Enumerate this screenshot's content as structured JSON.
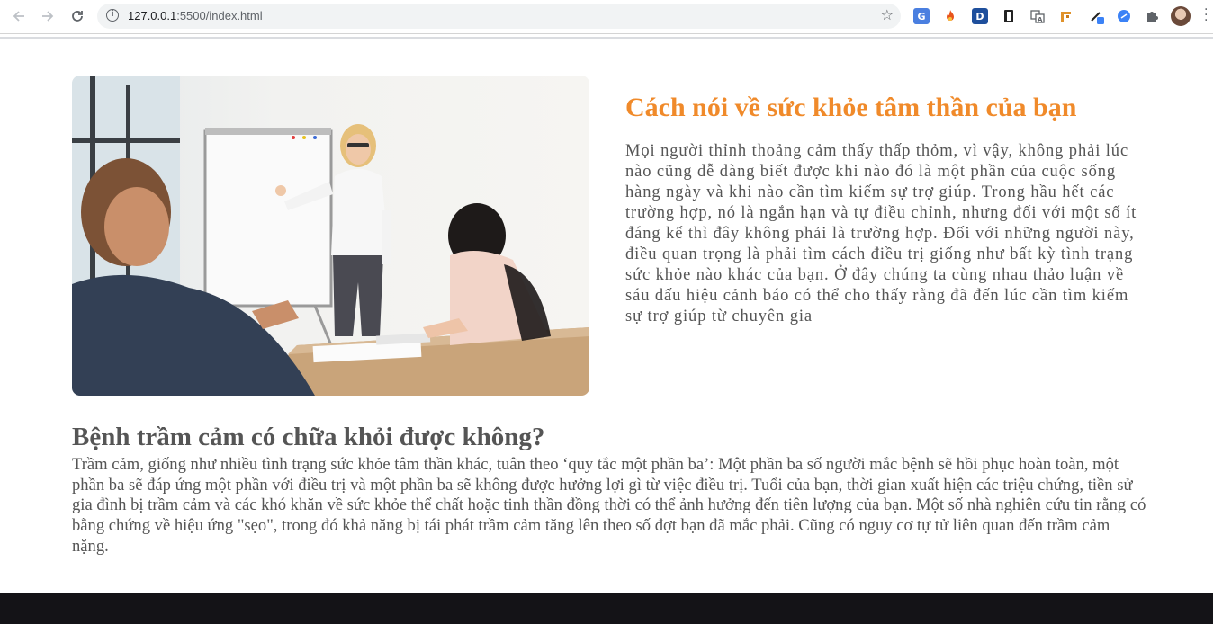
{
  "browser": {
    "url_host": "127.0.0.1",
    "url_rest": ":5500/index.html",
    "extensions": [
      "google-translate",
      "fire",
      "D",
      "bookmark",
      "translate",
      "tools",
      "pen",
      "link",
      "puzzle"
    ]
  },
  "hero": {
    "title": "Cách nói về sức khỏe tâm thần của bạn",
    "paragraph": "Mọi người thỉnh thoảng cảm thấy thấp thỏm, vì vậy, không phải lúc nào cũng dễ dàng biết được khi nào đó là một phần của cuộc sống hàng ngày và khi nào cần tìm kiếm sự trợ giúp. Trong hầu hết các trường hợp, nó là ngắn hạn và tự điều chỉnh, nhưng đối với một số ít đáng kể thì đây không phải là trường hợp. Đối với những người này, điều quan trọng là phải tìm cách điều trị giống như bất kỳ tình trạng sức khỏe nào khác của bạn. Ở đây chúng ta cùng nhau thảo luận về sáu dấu hiệu cảnh báo có thể cho thấy rằng đã đến lúc cần tìm kiếm sự trợ giúp từ chuyên gia"
  },
  "section": {
    "title": "Bệnh trầm cảm có chữa khỏi được không?",
    "paragraph": "Trầm cảm, giống như nhiều tình trạng sức khỏe tâm thần khác, tuân theo ‘quy tắc một phần ba’: Một phần ba số người mắc bệnh sẽ hồi phục hoàn toàn, một phần ba sẽ đáp ứng một phần với điều trị và một phần ba sẽ không được hưởng lợi gì từ việc điều trị. Tuổi của bạn, thời gian xuất hiện các triệu chứng, tiền sử gia đình bị trầm cảm và các khó khăn về sức khỏe thể chất hoặc tinh thần đồng thời có thể ảnh hưởng đến tiên lượng của bạn. Một số nhà nghiên cứu tin rằng có bằng chứng về hiệu ứng \"sẹo\", trong đó khả năng bị tái phát trầm cảm tăng lên theo số đợt bạn đã mắc phải. Cũng có nguy cơ tự tử liên quan đến trầm cảm nặng."
  },
  "colors": {
    "accent": "#f08a2a",
    "body_text": "#555555",
    "footer": "#141317"
  }
}
